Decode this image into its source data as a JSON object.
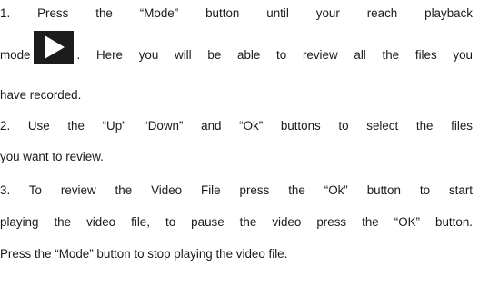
{
  "steps": {
    "step1_line1": "1. Press the “Mode” button until your reach playback",
    "step1_line2_before": "mode",
    "step1_line2_after": ". Here you will be able to review all the files you",
    "step1_line3": "have recorded.",
    "step2_line1": "2. Use the “Up” “Down” and “Ok” buttons to select the files",
    "step2_line2": "you want to review.",
    "step3_line1": "3. To review the Video File press the “Ok” button to start",
    "step3_line2": "playing the video file, to pause the video press the “OK” button.",
    "step3_line3": "Press the “Mode” button to stop playing the video file."
  },
  "icons": {
    "playback_mode": "play-icon"
  },
  "colors": {
    "text": "#1a1a1a",
    "icon_background": "#1c1c1c",
    "icon_glyph": "#ffffff"
  }
}
